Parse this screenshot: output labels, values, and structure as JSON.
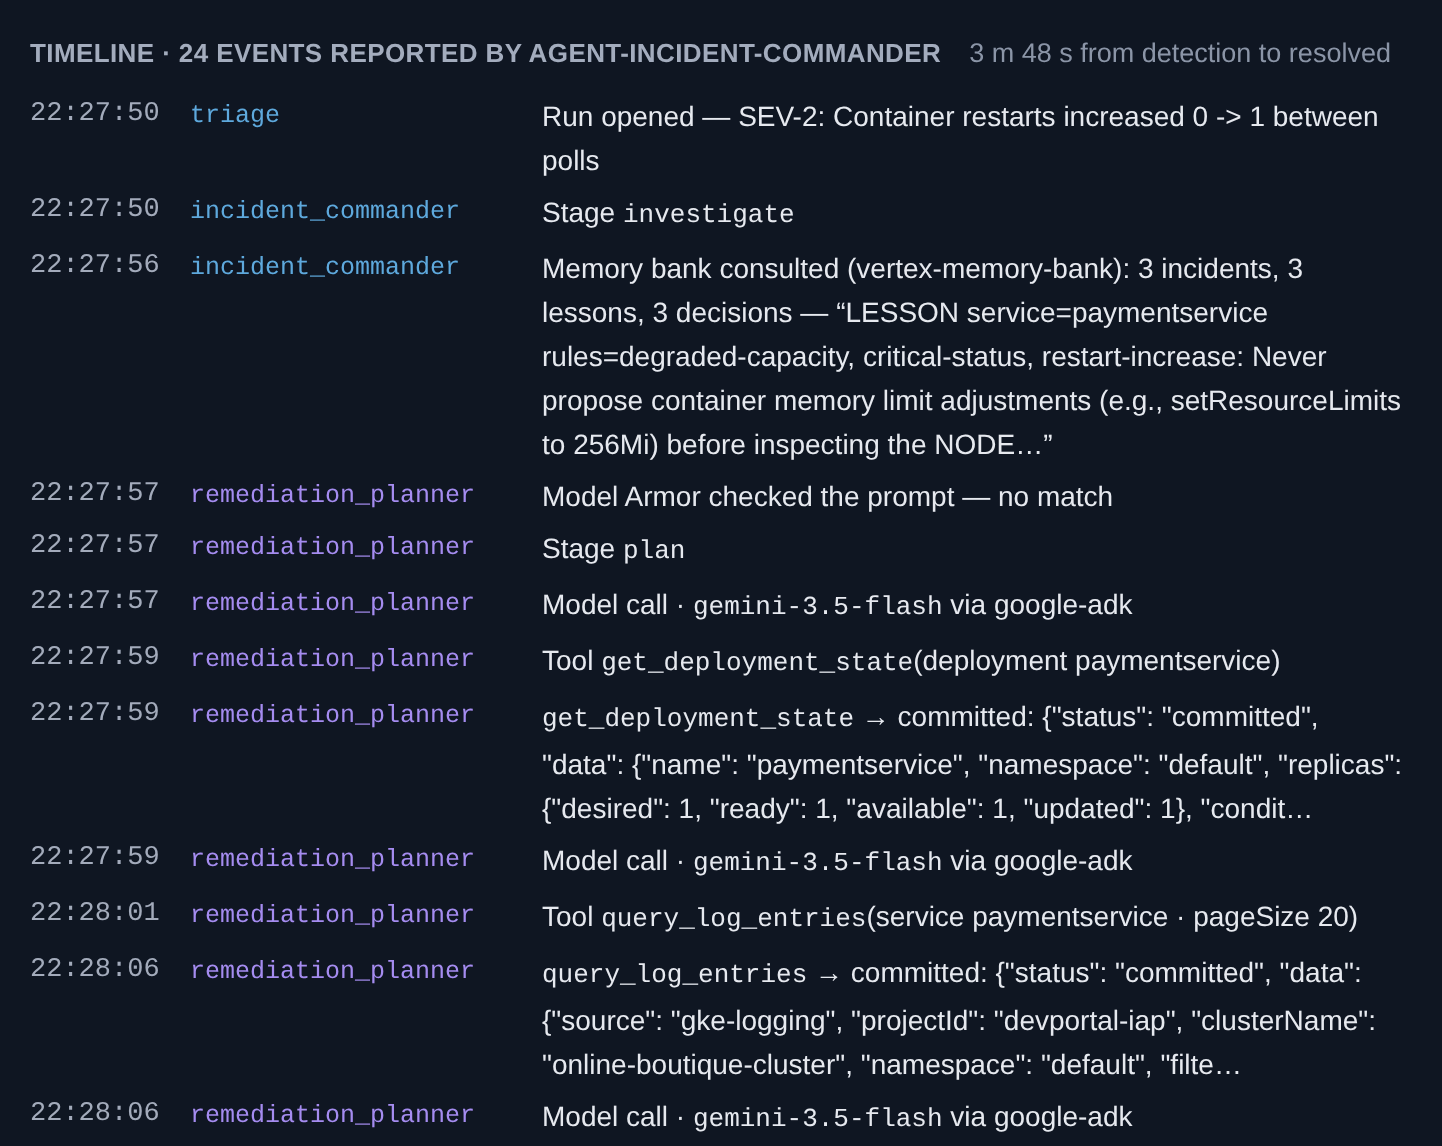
{
  "header": {
    "title": "TIMELINE · 24 EVENTS REPORTED BY AGENT-INCIDENT-COMMANDER",
    "duration": "3 m 48 s from detection to resolved"
  },
  "events": [
    {
      "time": "22:27:50",
      "agent": "triage",
      "color": "#5ea9dd",
      "message": [
        {
          "kind": "text",
          "text": "Run opened — SEV-2: Container restarts increased 0 -> 1 between polls"
        }
      ]
    },
    {
      "time": "22:27:50",
      "agent": "incident_commander",
      "color": "#5ea9dd",
      "message": [
        {
          "kind": "text",
          "text": "Stage "
        },
        {
          "kind": "code",
          "text": "investigate"
        }
      ]
    },
    {
      "time": "22:27:56",
      "agent": "incident_commander",
      "color": "#5ea9dd",
      "message": [
        {
          "kind": "text",
          "text": "Memory bank consulted (vertex-memory-bank): 3 incidents, 3 lessons, 3 decisions — “LESSON service=paymentservice rules=degraded-capacity, critical-status, restart-increase: Never propose container memory limit adjustments (e.g., setResourceLimits to 256Mi) before inspecting the NODE…”"
        }
      ]
    },
    {
      "time": "22:27:57",
      "agent": "remediation_planner",
      "color": "#a58cf0",
      "message": [
        {
          "kind": "text",
          "text": "Model Armor checked the prompt — no match"
        }
      ]
    },
    {
      "time": "22:27:57",
      "agent": "remediation_planner",
      "color": "#a58cf0",
      "message": [
        {
          "kind": "text",
          "text": "Stage "
        },
        {
          "kind": "code",
          "text": "plan"
        }
      ]
    },
    {
      "time": "22:27:57",
      "agent": "remediation_planner",
      "color": "#a58cf0",
      "message": [
        {
          "kind": "text",
          "text": "Model call · "
        },
        {
          "kind": "code",
          "text": "gemini-3.5-flash"
        },
        {
          "kind": "text",
          "text": " via google-adk"
        }
      ]
    },
    {
      "time": "22:27:59",
      "agent": "remediation_planner",
      "color": "#a58cf0",
      "message": [
        {
          "kind": "text",
          "text": "Tool "
        },
        {
          "kind": "code",
          "text": "get_deployment_state"
        },
        {
          "kind": "text",
          "text": "(deployment paymentservice)"
        }
      ]
    },
    {
      "time": "22:27:59",
      "agent": "remediation_planner",
      "color": "#a58cf0",
      "message": [
        {
          "kind": "code",
          "text": "get_deployment_state"
        },
        {
          "kind": "text",
          "text": " → committed: {\"status\": \"committed\", \"data\": {\"name\": \"paymentservice\", \"namespace\": \"default\", \"replicas\": {\"desired\": 1, \"ready\": 1, \"available\": 1, \"updated\": 1}, \"condit…"
        }
      ]
    },
    {
      "time": "22:27:59",
      "agent": "remediation_planner",
      "color": "#a58cf0",
      "message": [
        {
          "kind": "text",
          "text": "Model call · "
        },
        {
          "kind": "code",
          "text": "gemini-3.5-flash"
        },
        {
          "kind": "text",
          "text": " via google-adk"
        }
      ]
    },
    {
      "time": "22:28:01",
      "agent": "remediation_planner",
      "color": "#a58cf0",
      "message": [
        {
          "kind": "text",
          "text": "Tool "
        },
        {
          "kind": "code",
          "text": "query_log_entries"
        },
        {
          "kind": "text",
          "text": "(service paymentservice · pageSize 20)"
        }
      ]
    },
    {
      "time": "22:28:06",
      "agent": "remediation_planner",
      "color": "#a58cf0",
      "message": [
        {
          "kind": "code",
          "text": "query_log_entries"
        },
        {
          "kind": "text",
          "text": " → committed: {\"status\": \"committed\", \"data\": {\"source\": \"gke-logging\", \"projectId\": \"devportal-iap\", \"clusterName\": \"online-boutique-cluster\", \"namespace\": \"default\", \"filte…"
        }
      ]
    },
    {
      "time": "22:28:06",
      "agent": "remediation_planner",
      "color": "#a58cf0",
      "message": [
        {
          "kind": "text",
          "text": "Model call · "
        },
        {
          "kind": "code",
          "text": "gemini-3.5-flash"
        },
        {
          "kind": "text",
          "text": " via google-adk"
        }
      ]
    }
  ]
}
